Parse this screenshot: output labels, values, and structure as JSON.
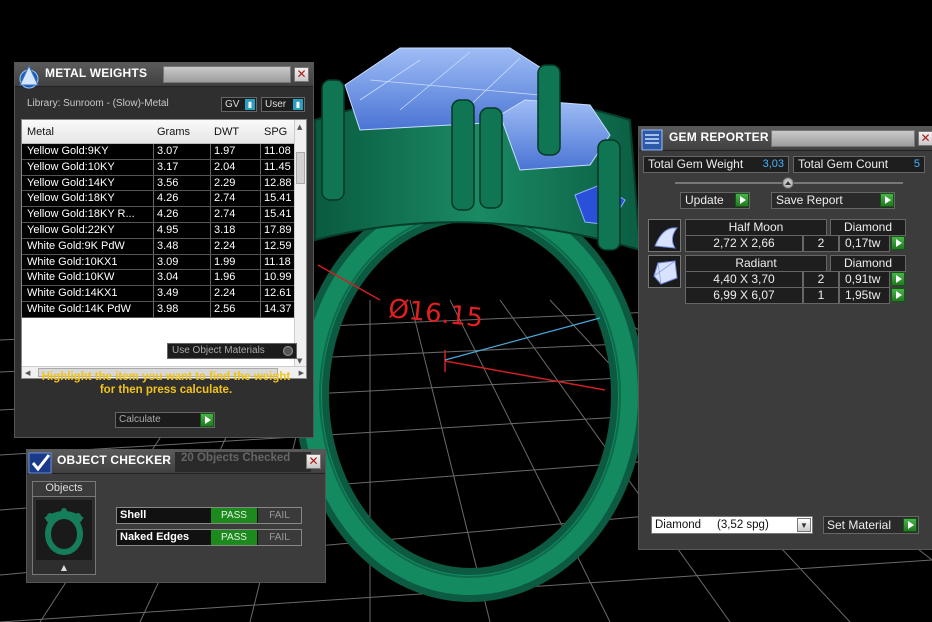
{
  "viewport": {
    "dimension_label": "Ø16.15",
    "colors": {
      "ring": "#0f6b4e",
      "gem": "#5a86e0",
      "dimension": "#e02020",
      "grid": "#6f6f6f"
    }
  },
  "metal_weights": {
    "title": "METAL WEIGHTS",
    "library": "Library: Sunroom - (Slow)-Metal",
    "toggle_gv": "GV",
    "toggle_user": "User",
    "columns": [
      "Metal",
      "Grams",
      "DWT",
      "SPG"
    ],
    "rows": [
      [
        "Yellow Gold:9KY",
        "3.07",
        "1.97",
        "11.08"
      ],
      [
        "Yellow Gold:10KY",
        "3.17",
        "2.04",
        "11.45"
      ],
      [
        "Yellow Gold:14KY",
        "3.56",
        "2.29",
        "12.88"
      ],
      [
        "Yellow Gold:18KY",
        "4.26",
        "2.74",
        "15.41"
      ],
      [
        "Yellow Gold:18KY R...",
        "4.26",
        "2.74",
        "15.41"
      ],
      [
        "Yellow Gold:22KY",
        "4.95",
        "3.18",
        "17.89"
      ],
      [
        "White Gold:9K PdW",
        "3.48",
        "2.24",
        "12.59"
      ],
      [
        "White Gold:10KX1",
        "3.09",
        "1.99",
        "11.18"
      ],
      [
        "White Gold:10KW",
        "3.04",
        "1.96",
        "10.99"
      ],
      [
        "White Gold:14KX1",
        "3.49",
        "2.24",
        "12.61"
      ],
      [
        "White Gold:14K PdW",
        "3.98",
        "2.56",
        "14.37"
      ]
    ],
    "use_object_materials": "Use Object Materials",
    "hint_line1": "Highlight the item you want to find the weight",
    "hint_line2": "for then press calculate.",
    "calculate": "Calculate"
  },
  "object_checker": {
    "title": "OBJECT CHECKER",
    "objects_checked": "20 Objects Checked",
    "objects_label": "Objects",
    "checks": [
      {
        "label": "Shell",
        "pass": "PASS",
        "fail": "FAIL"
      },
      {
        "label": "Naked Edges",
        "pass": "PASS",
        "fail": "FAIL"
      }
    ]
  },
  "gem_reporter": {
    "title": "GEM REPORTER",
    "total_weight_label": "Total Gem Weight",
    "total_weight_value": "3,03",
    "total_count_label": "Total Gem Count",
    "total_count_value": "5",
    "update": "Update",
    "save_report": "Save Report",
    "groups": [
      {
        "icon": "half-moon-gem-icon",
        "cut": "Half Moon",
        "material": "Diamond",
        "rows": [
          {
            "size": "2,72 X 2,66",
            "count": "2",
            "tw": "0,17tw"
          }
        ]
      },
      {
        "icon": "radiant-gem-icon",
        "cut": "Radiant",
        "material": "Diamond",
        "rows": [
          {
            "size": "4,40 X 3,70",
            "count": "2",
            "tw": "0,91tw"
          },
          {
            "size": "6,99 X 6,07",
            "count": "1",
            "tw": "1,95tw"
          }
        ]
      }
    ],
    "material_select": "Diamond     (3,52 spg)",
    "set_material": "Set Material"
  }
}
